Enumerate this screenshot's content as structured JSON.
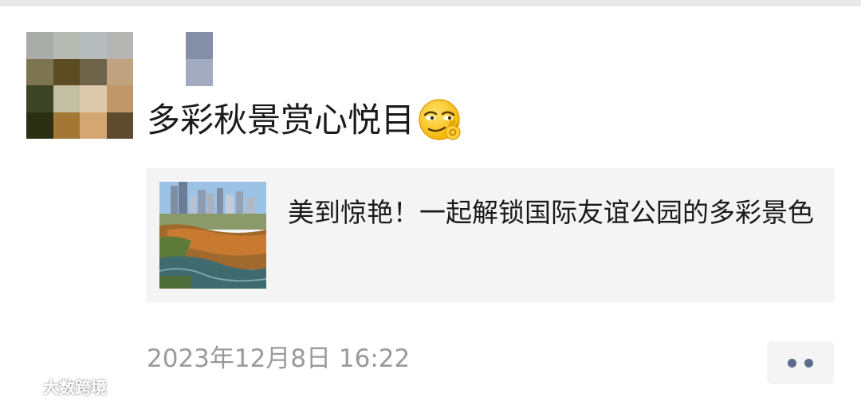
{
  "post": {
    "text": "多彩秋景赏心悦目",
    "emoji": "smirk-ok-hand-emoji"
  },
  "link_card": {
    "title": "美到惊艳！一起解锁国际友谊公园的多彩景色",
    "thumbnail": "park-autumn-scenery-image"
  },
  "timestamp": "2023年12月8日 16:22",
  "more_button": {
    "icon": "more-dots-icon"
  },
  "watermark": {
    "text": "大数跨境"
  },
  "colors": {
    "background": "#ffffff",
    "card_background": "#f4f4f4",
    "timestamp": "#9a9a9a",
    "dots": "#5b6c8f",
    "avatar_pixels": [
      "#a9aca7",
      "#b7b9b3",
      "#b6bcbd",
      "#b5b6b4",
      "#7d7450",
      "#5d4b24",
      "#6d644a",
      "#bfa27f",
      "#3b4424",
      "#c2bfa2",
      "#dcc9ac",
      "#bf9768",
      "#2a2e12",
      "#a27834",
      "#d4a672",
      "#5e4a2c"
    ],
    "nickname_pixels": [
      "#8390a8",
      "#a2abc0"
    ]
  }
}
